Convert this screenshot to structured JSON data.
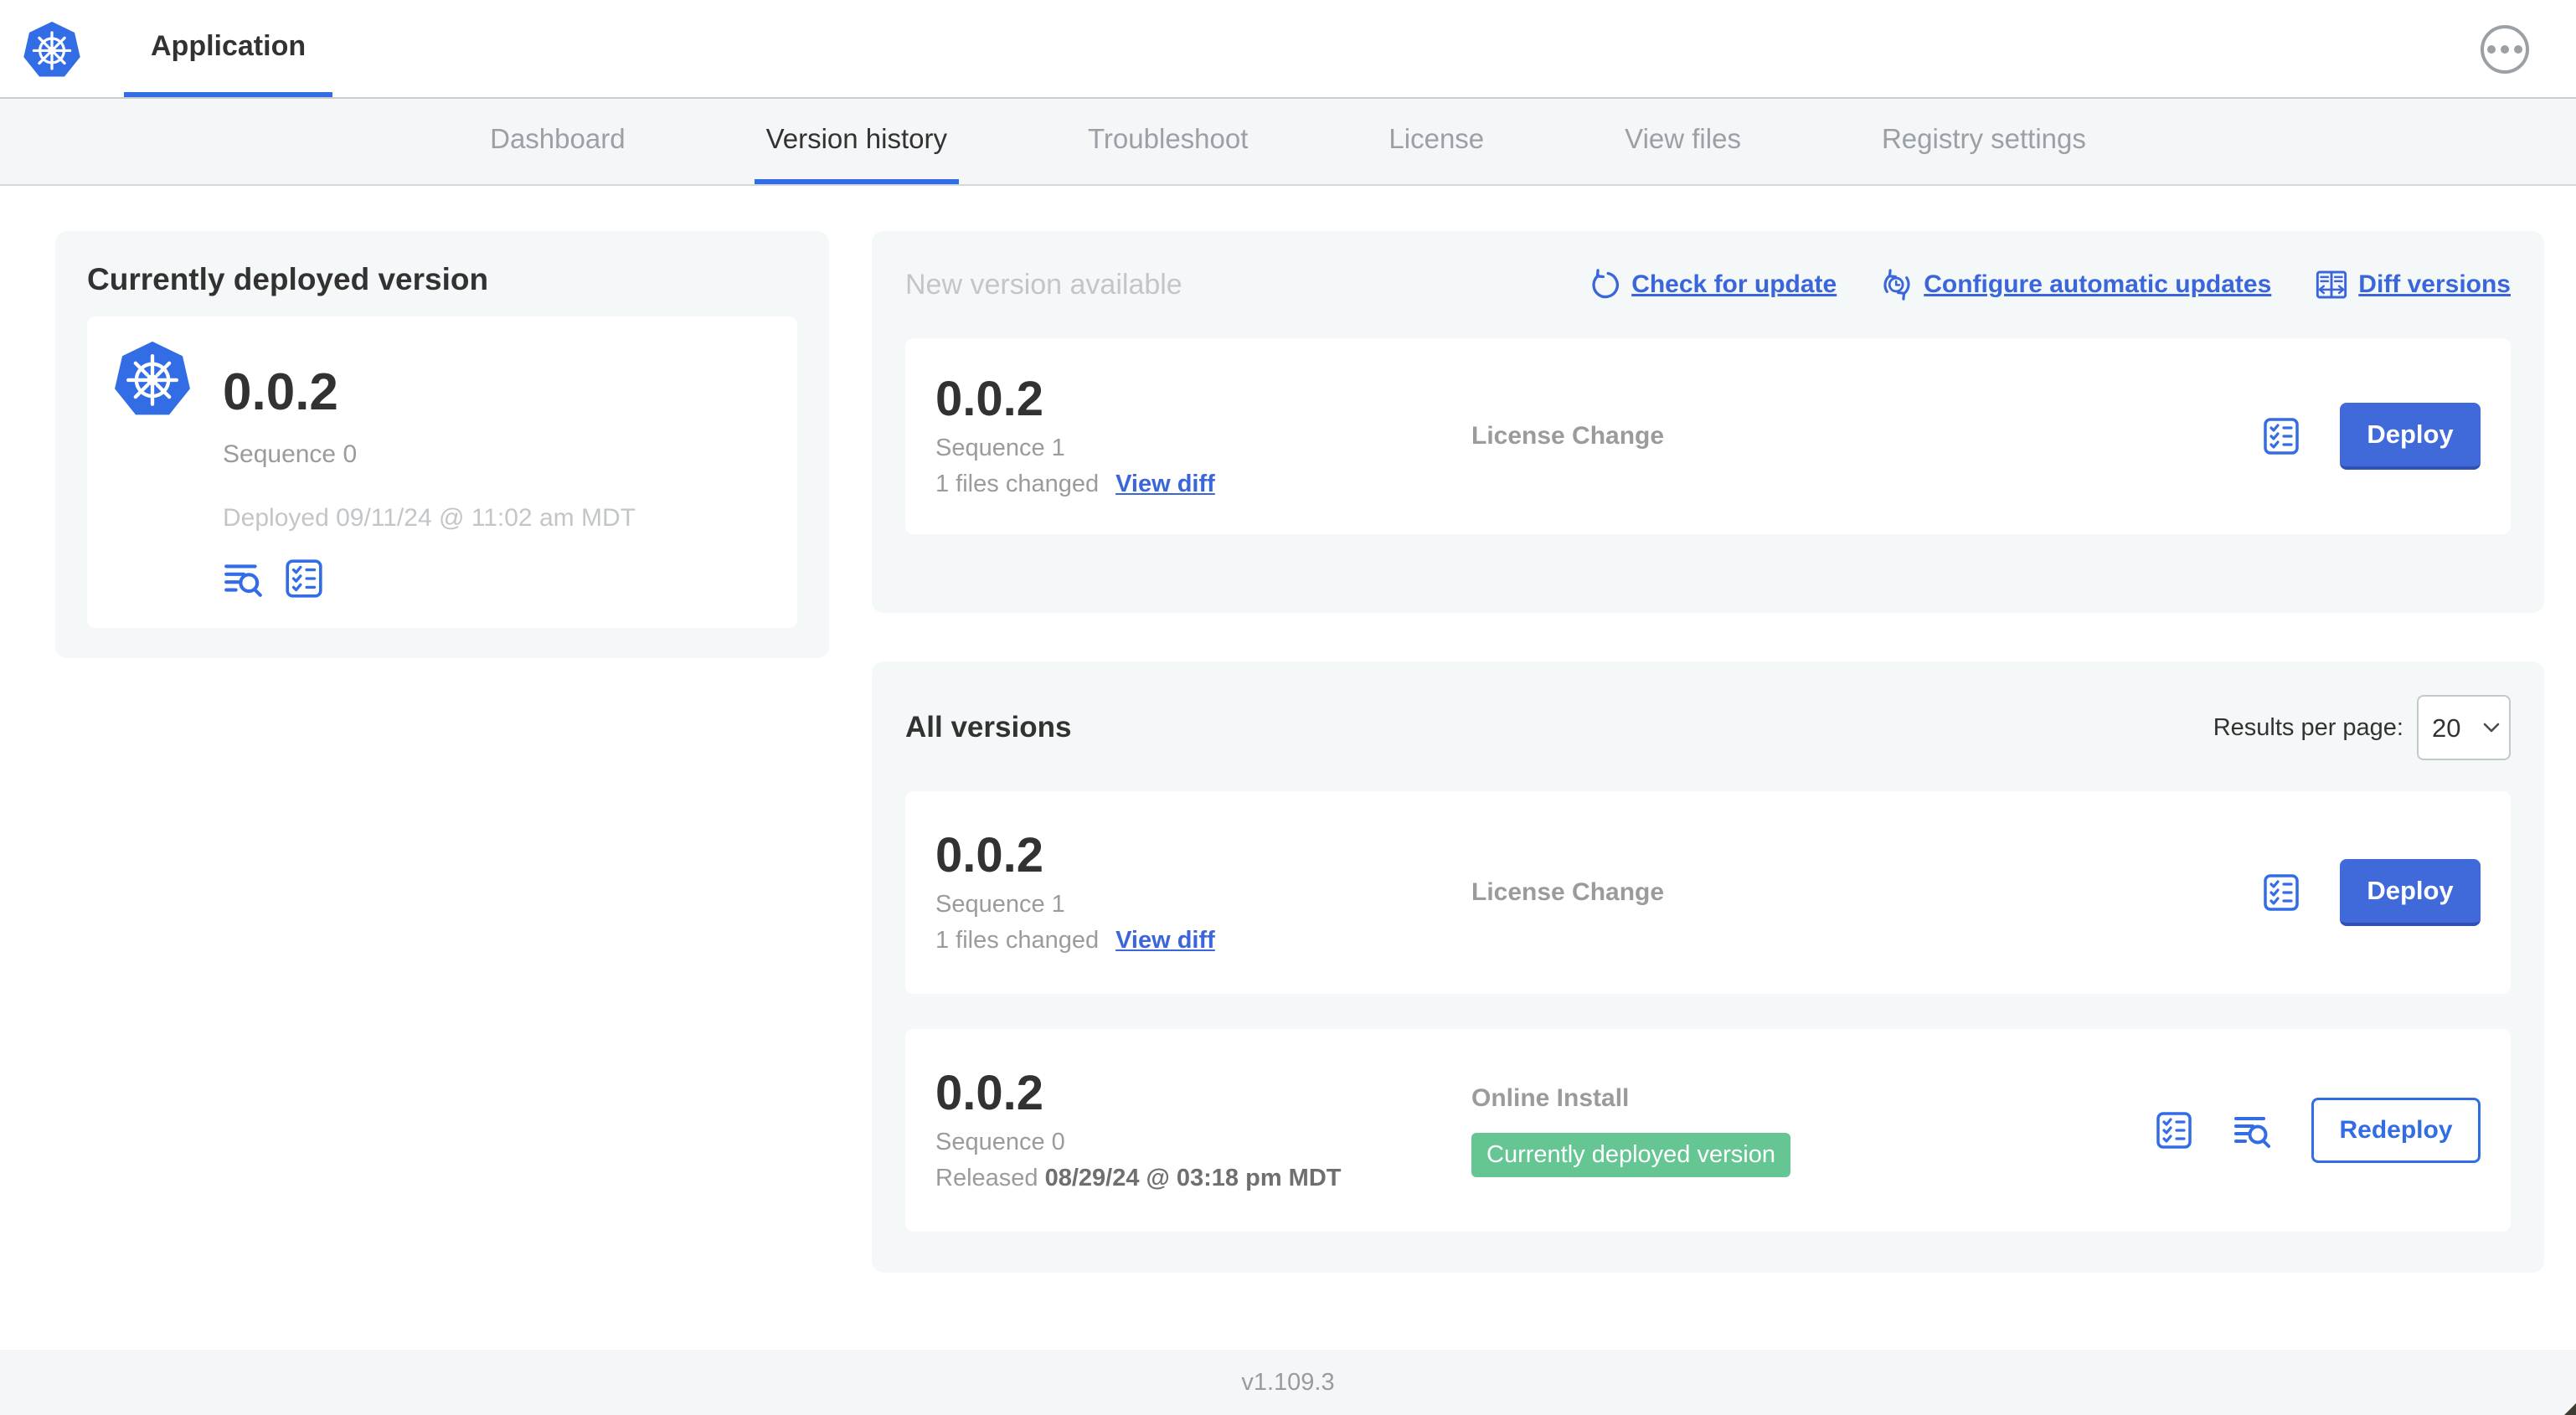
{
  "colors": {
    "primary_blue": "#326de6",
    "link_blue": "#3a66da",
    "button_blue": "#4069d9",
    "button_blue_dark": "#2d51b5",
    "success_green": "#65c694",
    "panel_bg": "#f5f8f9",
    "text_dark": "#323232",
    "text_gray": "#9b9b9b",
    "text_light_gray": "#c3c6c9"
  },
  "header": {
    "app_tab_label": "Application",
    "logo_icon": "kubernetes-wheel",
    "menu_icon": "ellipsis-circle"
  },
  "nav": {
    "tabs": [
      "Dashboard",
      "Version history",
      "Troubleshoot",
      "License",
      "View files",
      "Registry settings"
    ],
    "active_tab": "Version history"
  },
  "currently_deployed": {
    "title": "Currently deployed version",
    "version": "0.0.2",
    "sequence": "Sequence 0",
    "deployed_timestamp": "Deployed 09/11/24 @ 11:02 am MDT",
    "icons": [
      "view-logs",
      "preflight-checks"
    ]
  },
  "new_version": {
    "title": "New version available",
    "check_for_update_label": "Check for update",
    "configure_updates_label": "Configure automatic updates",
    "diff_versions_label": "Diff versions",
    "card": {
      "version": "0.0.2",
      "sequence": "Sequence 1",
      "files_changed": "1 files changed",
      "view_diff_label": "View diff",
      "source": "License Change",
      "deploy_label": "Deploy"
    }
  },
  "all_versions": {
    "title": "All versions",
    "results_per_page_label": "Results per page:",
    "results_per_page_value": "20",
    "rows": [
      {
        "version": "0.0.2",
        "sequence": "Sequence 1",
        "files_changed": "1 files changed",
        "view_diff_label": "View diff",
        "source": "License Change",
        "action_label": "Deploy"
      },
      {
        "version": "0.0.2",
        "sequence": "Sequence 0",
        "released_label": "Released",
        "released_timestamp": "08/29/24 @ 03:18 pm MDT",
        "source": "Online Install",
        "badge": "Currently deployed version",
        "action_label": "Redeploy"
      }
    ]
  },
  "footer": {
    "console_version": "v1.109.3"
  }
}
